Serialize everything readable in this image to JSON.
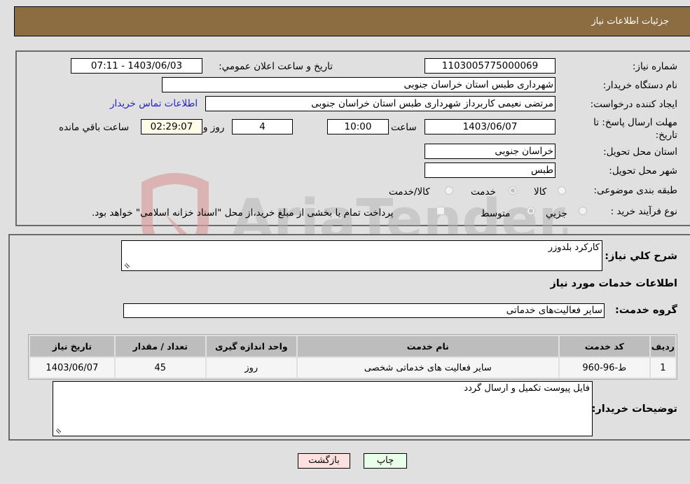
{
  "header": {
    "title": "جزئیات اطلاعات نیاز"
  },
  "details": {
    "need_number": {
      "label": "شماره نیاز:",
      "value": "1103005775000069"
    },
    "announce_datetime": {
      "label": "تاریخ و ساعت اعلان عمومي:",
      "value": "1403/06/03 - 07:11"
    },
    "buyer_org": {
      "label": "نام دستگاه خریدار:",
      "value": "شهرداری طبس استان خراسان جنوبی"
    },
    "requester": {
      "label": "ایجاد کننده درخواست:",
      "value": "مرتضی نعیمی کاربرداز شهرداری طبس استان خراسان جنوبی"
    },
    "buyer_contact_link": "اطلاعات تماس خریدار",
    "deadline": {
      "label": "مهلت ارسال پاسخ: تا تاریخ:",
      "date": "1403/06/07",
      "time_label": "ساعت",
      "time": "10:00",
      "days": "4",
      "days_label": "روز و",
      "remaining": "02:29:07",
      "remaining_label": "ساعت باقي مانده"
    },
    "delivery_province": {
      "label": "استان محل تحویل:",
      "value": "خراسان جنوبی"
    },
    "delivery_city": {
      "label": "شهر محل تحویل:",
      "value": "طبس"
    },
    "category": {
      "label": "طبقه بندی موضوعی:",
      "options": [
        "کالا",
        "خدمت",
        "کالا/خدمت"
      ],
      "selected": "خدمت"
    },
    "purchase_type": {
      "label": "نوع فرآیند خرید :",
      "options": [
        "جزيي",
        "متوسط"
      ],
      "selected": "متوسط",
      "treasury_note": "پرداخت تمام یا بخشی از مبلغ خرید،از محل \"اسناد خزانه اسلامی\" خواهد بود."
    }
  },
  "summary": {
    "description_label": "شرح كلي نياز:",
    "description_value": "کارکرد بلدوزر",
    "services_heading": "اطلاعات خدمات مورد نياز",
    "service_group_label": "گروه خدمت:",
    "service_group_value": "سایر فعالیت‌های خدماتی"
  },
  "table": {
    "headers": [
      "رديف",
      "کد خدمت",
      "نام خدمت",
      "واحد اندازه گیری",
      "تعداد / مقدار",
      "تاریخ نیاز"
    ],
    "rows": [
      [
        "1",
        "ط-96-960",
        "سایر فعالیت های خدماتی شخصی",
        "روز",
        "45",
        "1403/06/07"
      ]
    ]
  },
  "buyer_notes": {
    "label": "توضیحات خریدار:",
    "value": "فایل پیوست تکمیل و ارسال گردد"
  },
  "buttons": {
    "print": "چاپ",
    "back": "بازگشت"
  },
  "colors": {
    "header_bg": "#8c6d42",
    "back_bg": "#ffe0e0",
    "print_bg": "#eaffea",
    "link": "#2222cc"
  }
}
